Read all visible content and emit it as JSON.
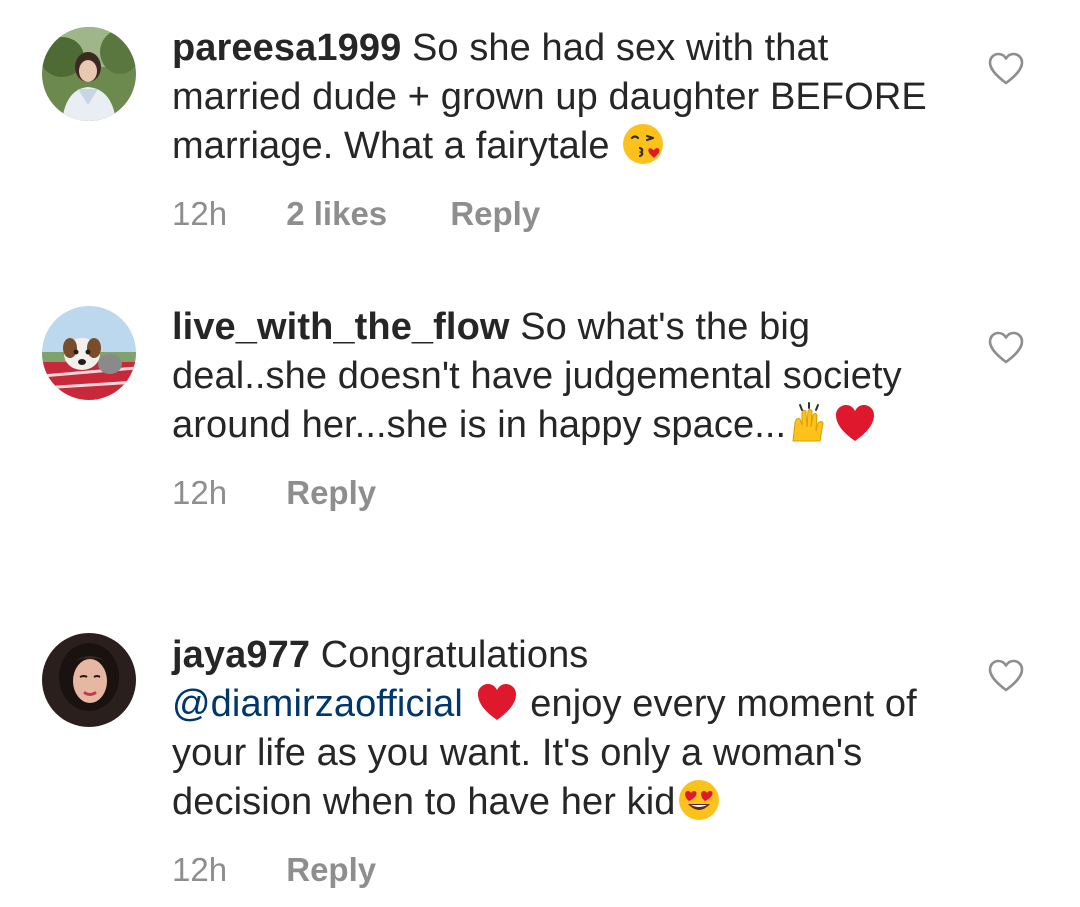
{
  "comments": [
    {
      "username": "pareesa1999",
      "text_parts": [
        "So she had sex with that married dude + grown up daughter BEFORE marriage. What a fairytale"
      ],
      "emojis": [
        "face-blowing-kiss"
      ],
      "time": "12h",
      "likes": "2 likes",
      "reply": "Reply",
      "avatar_icon": "user-photo-woman"
    },
    {
      "username": "live_with_the_flow",
      "text_parts": [
        "So what's the big deal..she doesn't have judgemental society around her...she is in happy space..."
      ],
      "emojis": [
        "raising-hands",
        "red-heart"
      ],
      "time": "12h",
      "reply": "Reply",
      "avatar_icon": "user-photo-dog"
    },
    {
      "username": "jaya977",
      "text_parts": [
        "Congratulations",
        "enjoy every moment of your life as you want. It's only a woman's decision when to have her kid"
      ],
      "mention": "@diamirzaofficial",
      "emojis": [
        "red-heart",
        "smiling-face-heart-eyes"
      ],
      "time": "12h",
      "reply": "Reply",
      "avatar_icon": "user-photo-woman"
    }
  ],
  "like_icon": "heart-outline-icon",
  "colors": {
    "text": "#262626",
    "meta": "#8e8e8e",
    "mention": "#00376b",
    "heart_red": "#e0182d",
    "emoji_yellow": "#fcc21b"
  }
}
